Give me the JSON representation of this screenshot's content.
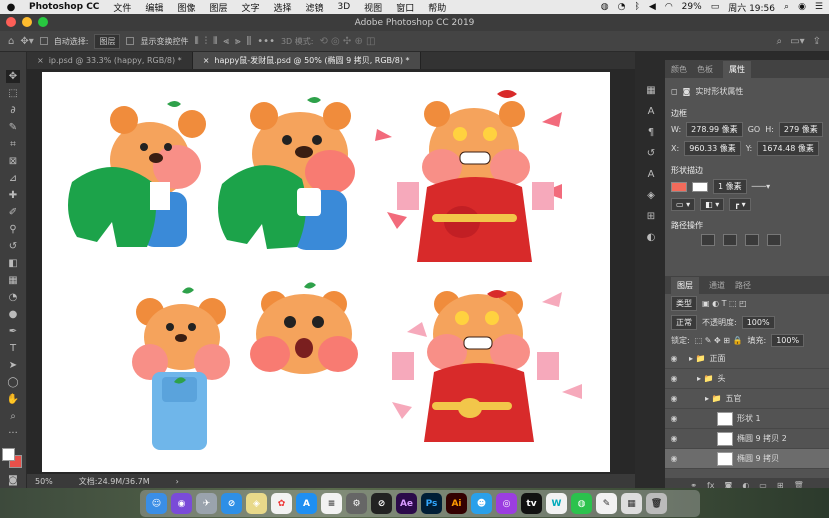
{
  "menubar": {
    "apple": "",
    "app_name": "Photoshop CC",
    "items": [
      "文件",
      "编辑",
      "图像",
      "图层",
      "文字",
      "选择",
      "滤镜",
      "3D",
      "视图",
      "窗口",
      "帮助"
    ],
    "battery": "29%",
    "clock": "周六 19:56"
  },
  "title": "Adobe Photoshop CC 2019",
  "options": {
    "auto_select": "自动选择:",
    "layer_value": "图层",
    "show_transform": "显示变换控件",
    "mode_3d": "3D 模式:"
  },
  "tabs": [
    {
      "label": "ip.psd @ 33.3% (happy, RGB/8) *"
    },
    {
      "label": "happy鼠-发财鼠.psd @ 50% (椭圆 9 拷贝, RGB/8) *"
    }
  ],
  "status": {
    "zoom": "50%",
    "doc": "文档:24.9M/36.7M"
  },
  "props": {
    "tabs": [
      "颜色",
      "色板",
      "属性"
    ],
    "title": "实时形状属性",
    "section_bounds": "边框",
    "w_label": "W:",
    "w_value": "278.99 像素",
    "go_label": "GO",
    "h_label": "H:",
    "h_value": "279 像素",
    "x_label": "X:",
    "x_value": "960.33 像素",
    "y_label": "Y:",
    "y_value": "1674.48 像素",
    "section_shape": "形状描边",
    "stroke_value": "1 像素",
    "section_path": "路径操作",
    "fill_color": "#f26b5b"
  },
  "layers": {
    "tabs": [
      "图层",
      "通道",
      "路径"
    ],
    "kind_value": "类型",
    "blend_value": "正常",
    "opacity_label": "不透明度:",
    "opacity_value": "100%",
    "lock_label": "锁定:",
    "fill_label": "填充:",
    "fill_value": "100%",
    "rows": [
      {
        "name": "正面"
      },
      {
        "name": "头"
      },
      {
        "name": "五官"
      },
      {
        "name": "形状 1"
      },
      {
        "name": "椭圆 9 拷贝 2"
      },
      {
        "name": "椭圆 9 拷贝"
      }
    ]
  }
}
